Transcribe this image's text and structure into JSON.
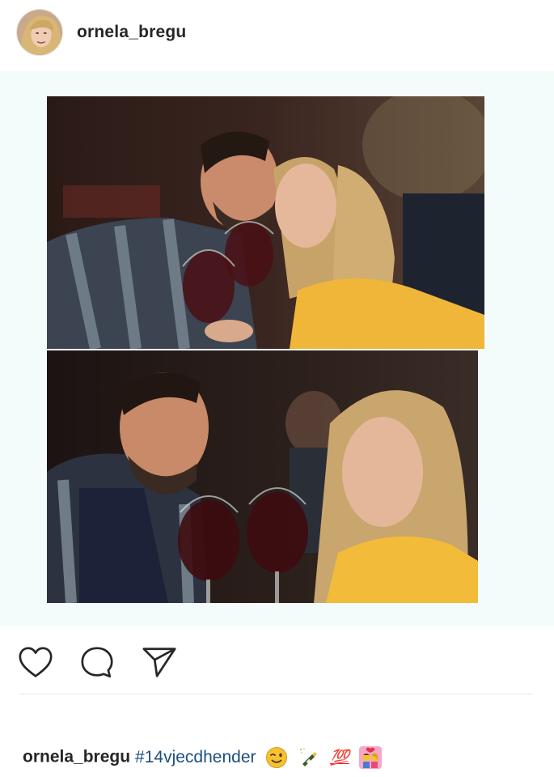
{
  "header": {
    "username": "ornela_bregu",
    "avatar_icon": "profile-photo"
  },
  "post": {
    "photo_top_desc_icon": "photo",
    "photo_bottom_desc_icon": "photo"
  },
  "actions": {
    "like_icon": "heart-outline-icon",
    "comment_icon": "speech-bubble-icon",
    "share_icon": "paper-plane-icon"
  },
  "caption": {
    "username": "ornela_bregu",
    "hashtag": "#14vjecdhender",
    "emoji_100": "💯",
    "emojis": [
      "winking-face",
      "champagne-bottle",
      "hundred-points",
      "couple-kiss"
    ]
  },
  "colors": {
    "hashtag": "#1d4f7f",
    "post_background": "#f3fbfb",
    "accent_yellow": "#f4c327"
  }
}
